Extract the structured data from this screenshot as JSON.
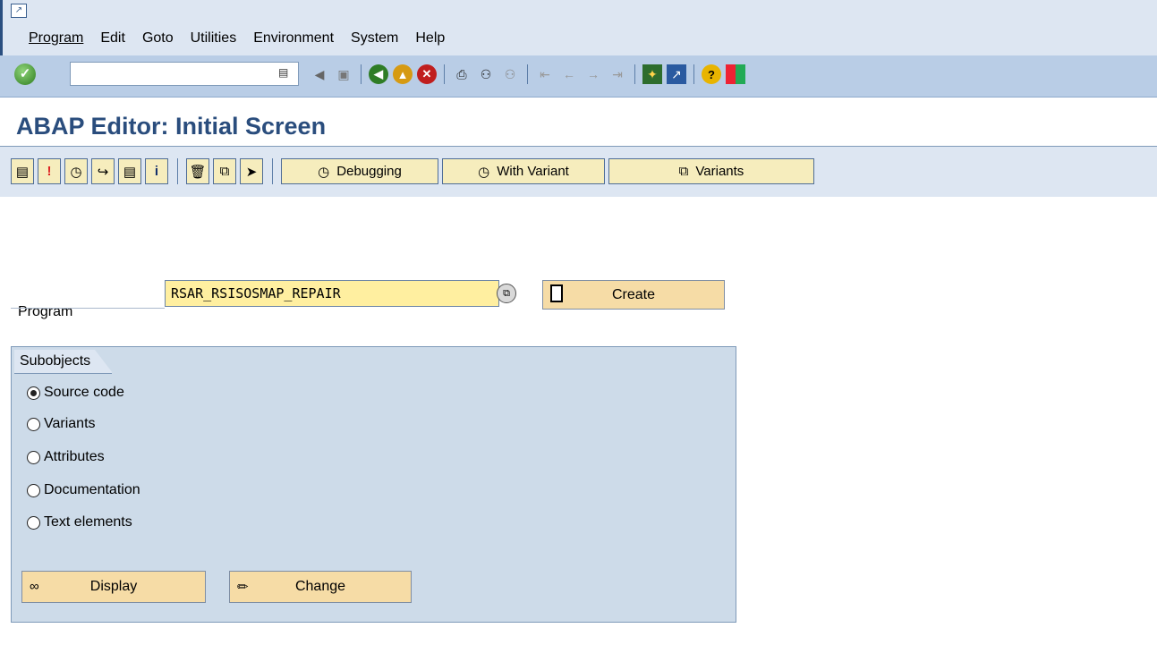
{
  "menu": {
    "items": [
      "Program",
      "Edit",
      "Goto",
      "Utilities",
      "Environment",
      "System",
      "Help"
    ]
  },
  "std_toolbar": {
    "command_field_value": "",
    "icons": [
      "enter-icon",
      "back-icon",
      "save-icon",
      "back-green-icon",
      "exit-icon",
      "cancel-icon",
      "print-icon",
      "find-icon",
      "find-next-icon",
      "first-page-icon",
      "previous-page-icon",
      "next-page-icon",
      "last-page-icon",
      "create-session-icon",
      "shortcut-icon",
      "help-icon",
      "customize-layout-icon"
    ]
  },
  "page": {
    "title": "ABAP Editor: Initial Screen"
  },
  "app_toolbar": {
    "debugging_label": "Debugging",
    "with_variant_label": "With Variant",
    "variants_label": "Variants"
  },
  "program": {
    "label": "Program",
    "value": "RSAR_RSISOSMAP_REPAIR",
    "create_label": "Create"
  },
  "subobjects": {
    "title": "Subobjects",
    "options": [
      "Source code",
      "Variants",
      "Attributes",
      "Documentation",
      "Text elements"
    ],
    "selected": "Source code",
    "display_label": "Display",
    "change_label": "Change"
  },
  "colors": {
    "title": "#2a4d7d",
    "toolbar": "#b9cde6",
    "input_required": "#ffefa0",
    "button": "#f6dca6",
    "group": "#cddbe9"
  }
}
